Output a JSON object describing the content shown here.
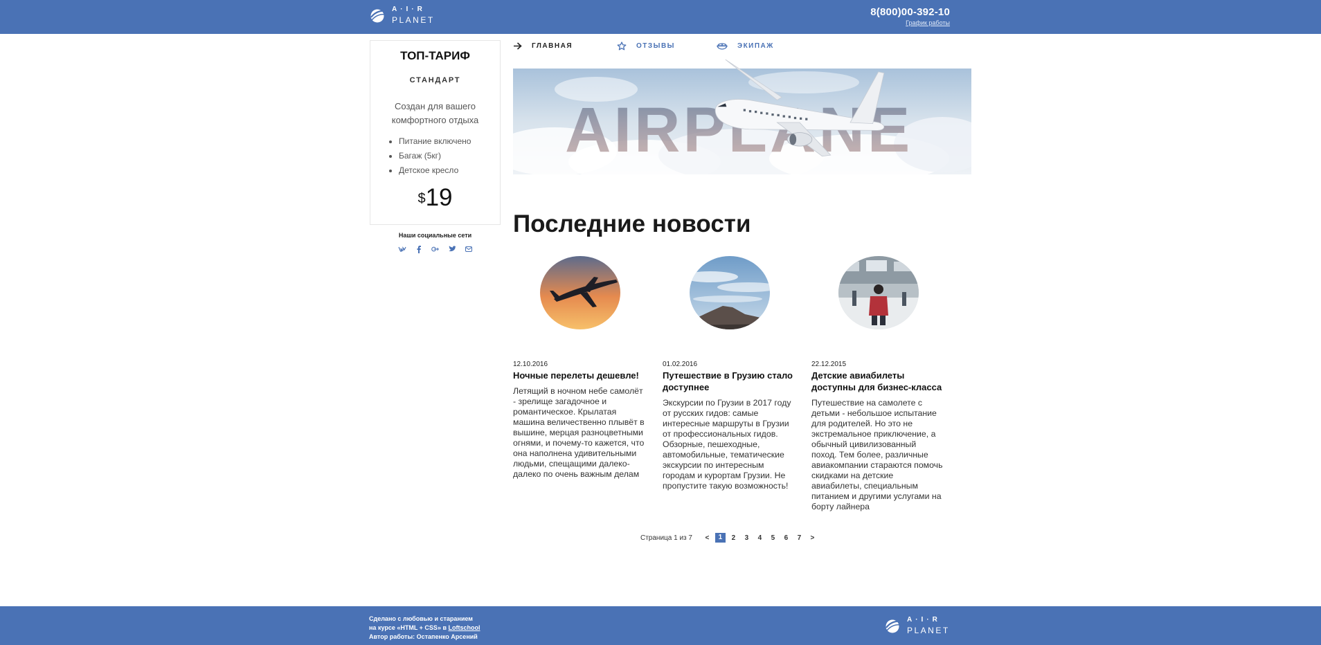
{
  "header": {
    "logo": {
      "top": "A·I·R",
      "bottom": "PLANET"
    },
    "phone": "8(800)00-392-10",
    "hours_link": "График работы"
  },
  "sidebar": {
    "tariff_title": "ТОП-ТАРИФ",
    "tariff_subtitle": "СТАНДАРТ",
    "description": "Создан для вашего комфортного отдыха",
    "features": [
      "Питание включено",
      "Багаж (5кг)",
      "Детское кресло"
    ],
    "price_currency": "$",
    "price_value": "19",
    "social_title": "Наши социальные сети",
    "social_icons": [
      "vk-icon",
      "facebook-icon",
      "google-plus-icon",
      "twitter-icon",
      "mail-icon"
    ]
  },
  "nav": {
    "items": [
      {
        "label": "ГЛАВНАЯ",
        "icon": "arrow-right-icon"
      },
      {
        "label": "ОТЗЫВЫ",
        "icon": "star-icon"
      },
      {
        "label": "ЭКИПАЖ",
        "icon": "pilot-cap-icon"
      }
    ]
  },
  "banner": {
    "text": "AIRPLANE"
  },
  "news": {
    "title": "Последние новости",
    "items": [
      {
        "date": "12.10.2016",
        "headline": "Ночные перелеты дешевле!",
        "body": "Летящий в ночном небе самолёт - зрелище загадочное и романтическое. Крылатая машина величественно плывёт в вышине, мерцая разноцветными огнями, и почему-то кажется, что она наполнена удивительными людьми, спещащими далеко-далеко по очень важным делам"
      },
      {
        "date": "01.02.2016",
        "headline": "Путешествие в Грузию стало доступнее",
        "body": "Экскурсии по Грузии в 2017 году от русских гидов: самые интересные маршруты в Грузии от профессиональных гидов. Обзорные, пешеходные, автомобильные, тематические экскурсии по интересным городам и курортам Грузии. Не пропустите такую возможность!"
      },
      {
        "date": "22.12.2015",
        "headline": "Детские авиабилеты доступны для бизнес-класса",
        "body": "Путешествие на самолете с детьми - небольшое испытание для родителей. Но это не экстремальное приключение, а обычный цивилизованный поход. Тем более, различные авиакомпании стараются помочь скидками на детские авиабилеты, специальным питанием и другими услугами на борту лайнера"
      }
    ]
  },
  "pagination": {
    "info": "Страница 1 из 7",
    "prev": "<",
    "pages": [
      "1",
      "2",
      "3",
      "4",
      "5",
      "6",
      "7"
    ],
    "current": "1",
    "next": ">"
  },
  "footer": {
    "line1": "Сделано с любовью и старанием",
    "line2_prefix": "на курсе «HTML + CSS» в ",
    "line2_link": "Loftschool",
    "line3": "Автор работы: Остапенко Арсений",
    "logo": {
      "top": "A·I·R",
      "bottom": "PLANET"
    }
  },
  "colors": {
    "accent": "#4a72b5",
    "text": "#222222",
    "background": "#ffffff"
  }
}
